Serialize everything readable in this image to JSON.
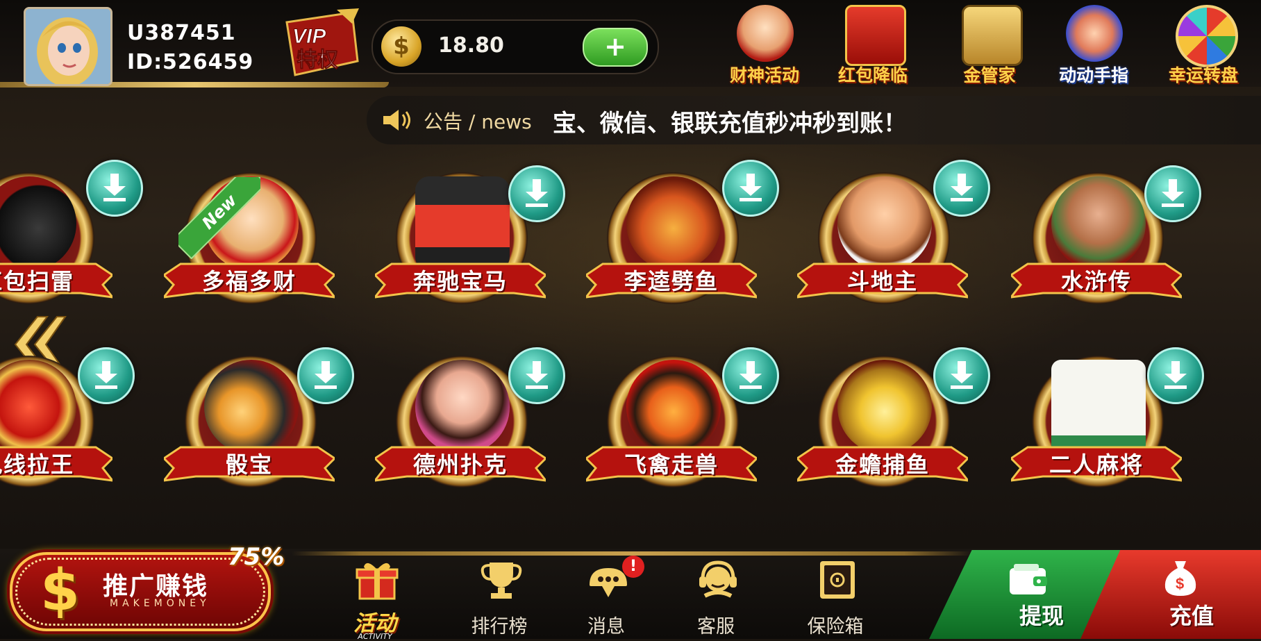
{
  "user": {
    "username": "U387451",
    "id": "ID:526459"
  },
  "vip": {
    "line1": "VIP",
    "line2": "特权"
  },
  "wallet": {
    "balance": "18.80",
    "coin_symbol": "$",
    "add_symbol": "+"
  },
  "promos": [
    {
      "label": "财神活动",
      "icon": "god-of-wealth-icon"
    },
    {
      "label": "红包降临",
      "icon": "red-envelope-icon"
    },
    {
      "label": "金管家",
      "icon": "abacus-steward-icon"
    },
    {
      "label": "动动手指",
      "icon": "pointing-finger-icon"
    },
    {
      "label": "幸运转盘",
      "icon": "lucky-wheel-icon"
    }
  ],
  "news": {
    "label": "公告 / news",
    "text": "宝、微信、银联充值秒冲秒到账！"
  },
  "games_row1": [
    {
      "name": "红包扫雷",
      "icon": "bomb-icon"
    },
    {
      "name": "多福多财",
      "icon": "fortune-god-icon",
      "tag": "New"
    },
    {
      "name": "奔驰宝马",
      "icon": "sports-car-icon"
    },
    {
      "name": "李逵劈鱼",
      "icon": "warrior-fish-icon"
    },
    {
      "name": "斗地主",
      "icon": "landlord-icon"
    },
    {
      "name": "水浒传",
      "icon": "outlaw-icon"
    }
  ],
  "games_row2": [
    {
      "name": "九线拉王",
      "icon": "lucky-seven-icon"
    },
    {
      "name": "骰宝",
      "icon": "dice-icon"
    },
    {
      "name": "德州扑克",
      "icon": "poker-girl-icon"
    },
    {
      "name": "飞禽走兽",
      "icon": "tiger-phoenix-icon"
    },
    {
      "name": "金蟾捕鱼",
      "icon": "golden-toad-icon"
    },
    {
      "name": "二人麻将",
      "icon": "mahjong-tile-icon"
    }
  ],
  "bottom": {
    "makemoney": {
      "title": "推广赚钱",
      "sub": "MAKEMONEY",
      "percent": "75%"
    },
    "nav": [
      {
        "label": "活动",
        "sub": "ACTIVITY",
        "icon": "gift-box-icon",
        "active": true
      },
      {
        "label": "排行榜",
        "icon": "trophy-icon"
      },
      {
        "label": "消息",
        "icon": "message-icon",
        "badge": "!"
      },
      {
        "label": "客服",
        "icon": "customer-service-icon"
      },
      {
        "label": "保险箱",
        "icon": "safe-box-icon"
      }
    ],
    "withdraw": "提现",
    "recharge": "充值"
  },
  "colors": {
    "accent_gold": "#ffd24a",
    "ribbon_red": "#b5120e",
    "download_teal": "#1f9a86",
    "withdraw_green": "#2fb34a",
    "recharge_red": "#e83a2c"
  }
}
